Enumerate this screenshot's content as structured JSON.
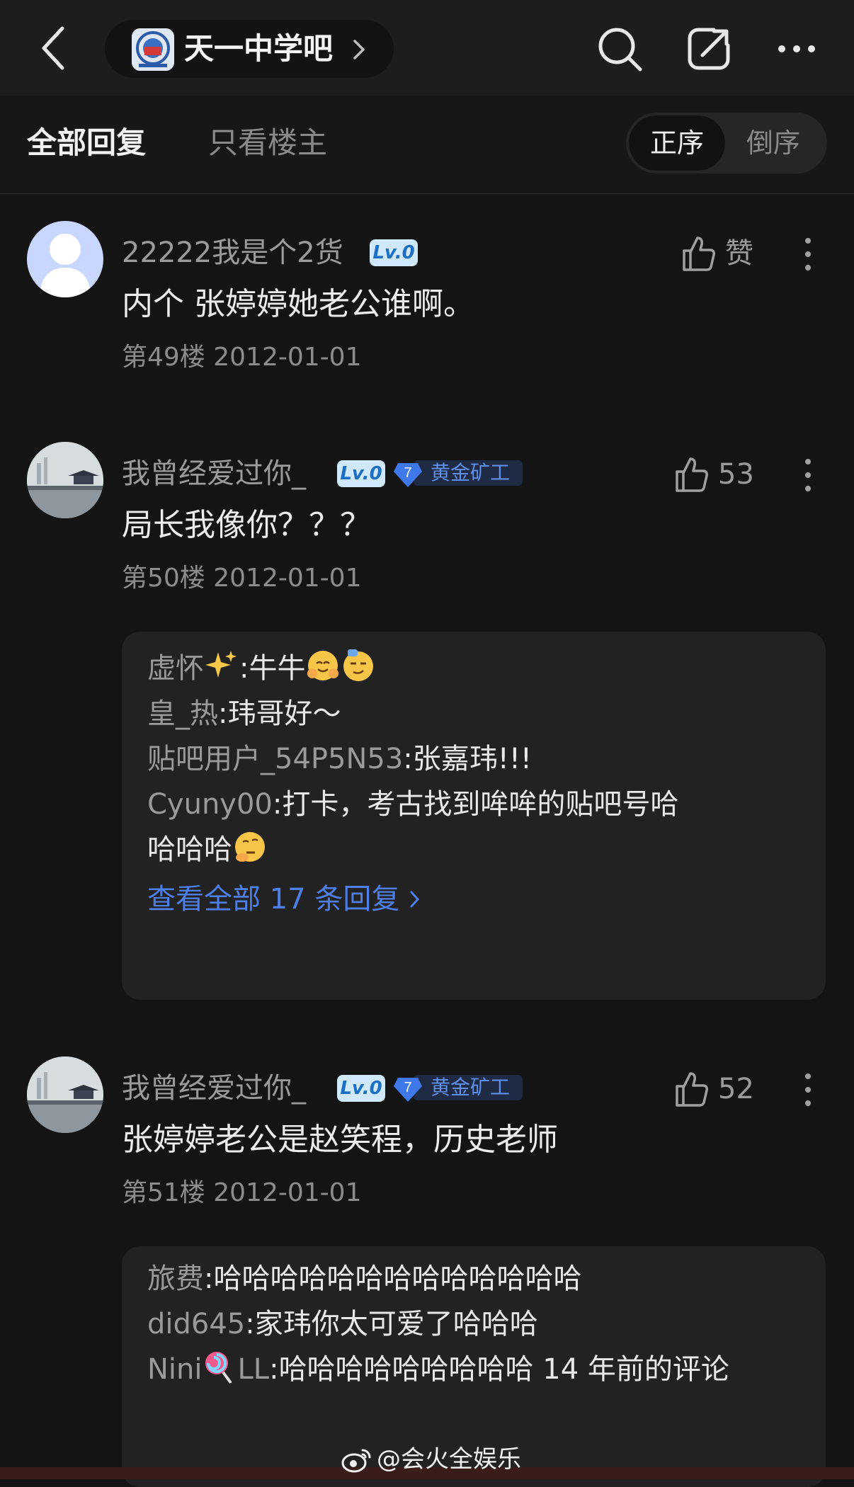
{
  "header": {
    "forum_name": "天一中学吧",
    "icons": [
      "back-icon",
      "search-icon",
      "share-icon",
      "more-icon"
    ]
  },
  "tabs": {
    "all_replies": "全部回复",
    "op_only": "只看楼主",
    "order_asc": "正序",
    "order_desc": "倒序"
  },
  "posts": [
    {
      "username": "22222我是个2货",
      "level": "Lv.0",
      "like_label": "赞",
      "content": "内个 张婷婷她老公谁啊。",
      "meta": "第49楼 2012-01-01"
    },
    {
      "username": "我曾经爱过你_",
      "level": "Lv.0",
      "badge_num": "7",
      "badge_title": "黄金矿工",
      "like_label": "53",
      "content": "局长我像你？？？",
      "meta": "第50楼 2012-01-01",
      "replies": [
        {
          "name": "虚怀",
          "sep": ":",
          "text": "牛牛"
        },
        {
          "name": "皇_热",
          "sep": ":",
          "text": "玮哥好～"
        },
        {
          "name": "贴吧用户_54P5N53",
          "sep": ":",
          "text": "张嘉玮!!!"
        },
        {
          "name": "Cyuny00",
          "sep": ":",
          "text": "打卡，考古找到哞哞的贴吧号哈哈哈哈"
        }
      ],
      "view_all": "查看全部 17 条回复"
    },
    {
      "username": "我曾经爱过你_",
      "level": "Lv.0",
      "badge_num": "7",
      "badge_title": "黄金矿工",
      "like_label": "52",
      "content": "张婷婷老公是赵笑程，历史老师",
      "meta": "第51楼 2012-01-01",
      "replies": [
        {
          "name": "旅费",
          "sep": ":",
          "text": "哈哈哈哈哈哈哈哈哈哈哈哈哈"
        },
        {
          "name": "did645",
          "sep": ":",
          "text": "家玮你太可爱了哈哈哈"
        },
        {
          "name": "Nini",
          "name2": "LL",
          "sep": ":",
          "text": "哈哈哈哈哈哈哈哈哈 14 年前的评论"
        }
      ]
    }
  ],
  "watermark": "@会火全娱乐",
  "colors": {
    "background": "#141414",
    "link_blue": "#4d7fe6",
    "level_badge": "#cfe9fb",
    "gold_badge_text": "#5f8fe6"
  }
}
